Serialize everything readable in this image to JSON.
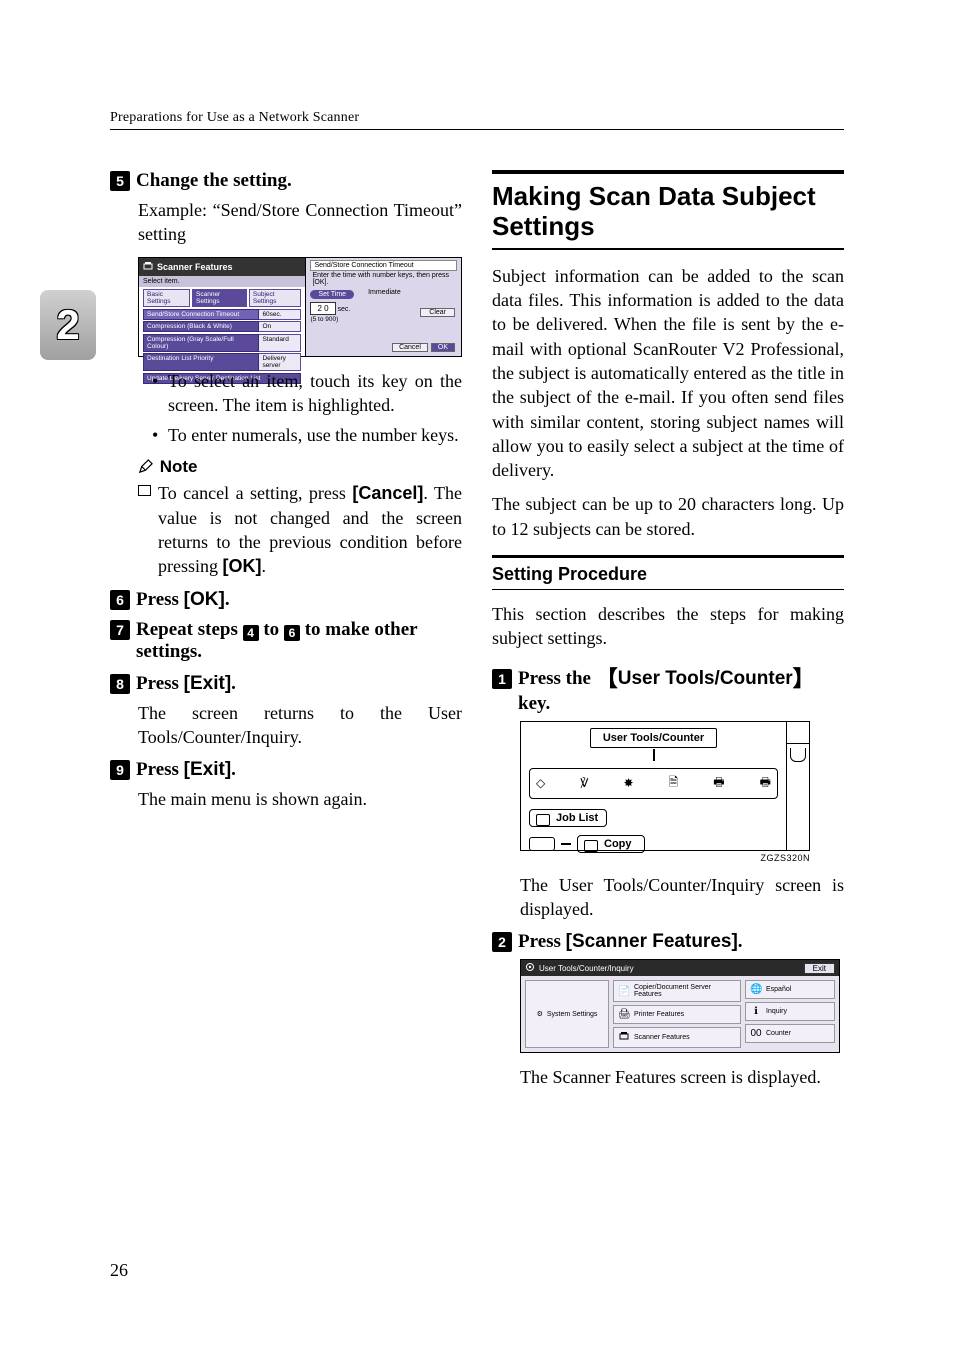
{
  "running_head": "Preparations for Use as a Network Scanner",
  "side_tab": "2",
  "page_number": "26",
  "left": {
    "step5": {
      "num": "5",
      "title": "Change the setting.",
      "example": "Example: “Send/Store Connection Timeout” setting",
      "bullet1": "To select an item, touch its key on the screen. The item is highlighted.",
      "bullet2": "To enter numerals, use the number keys.",
      "note_head": "Note",
      "note_body_a": "To cancel a setting, press ",
      "note_cancel": "[Cancel]",
      "note_body_b": ". The value is not changed and the screen returns to the previous condition before pressing ",
      "note_ok": "[OK]",
      "note_body_c": "."
    },
    "step6": {
      "num": "6",
      "a": "Press ",
      "b": "[OK]",
      "c": "."
    },
    "step7": {
      "num": "7",
      "a": "Repeat steps ",
      "s1": "4",
      "mid": " to ",
      "s2": "6",
      "b": " to make other settings."
    },
    "step8": {
      "num": "8",
      "a": "Press ",
      "b": "[Exit]",
      "c": ".",
      "body": "The screen returns to the User Tools/Counter/Inquiry."
    },
    "step9": {
      "num": "9",
      "a": "Press ",
      "b": "[Exit]",
      "c": ".",
      "body": "The main menu is shown again."
    },
    "shot": {
      "title": "Scanner Features",
      "select": "Select item.",
      "tab1": "Basic Settings",
      "tab2": "Scanner Settings",
      "tab3": "Subject Settings",
      "row1k": "Send/Store Connection Timeout",
      "row1v": "60sec.",
      "row2k": "Compression (Black & White)",
      "row2v": "On",
      "row3k": "Compression (Gray Scale/Full Colour)",
      "row3v": "Standard",
      "row4k": "Destination List Priority",
      "row4v": "Delivery server",
      "row5k": "Update Delivery Server Destination List",
      "rtitle": "Send/Store Connection Timeout",
      "rsub": "Enter the time with number keys, then press [OK].",
      "pill": "Set Time",
      "imm": "Immediate",
      "val": "2 0",
      "unit": "sec.",
      "range": "(5 to 900)",
      "clear": "Clear",
      "cancel": "Cancel",
      "ok": "OK"
    }
  },
  "right": {
    "h2": "Making Scan Data Subject Settings",
    "p1": "Subject information can be added to the scan data files. This information is added to the data to be delivered. When the file is sent by the e-mail with optional ScanRouter V2 Professional, the subject is automatically entered as the title in the subject of the e-mail. If you often send files with similar content, storing subject names will allow you to easily select a subject at the time of delivery.",
    "p2": "The subject can be up to 20 characters long. Up to 12 subjects can be stored.",
    "h3": "Setting Procedure",
    "p3": "This section describes the steps for making subject settings.",
    "step1": {
      "num": "1",
      "a": "Press the ",
      "key": "User Tools/Counter",
      "b": " key."
    },
    "panel": {
      "ut": "User Tools/Counter",
      "joblist": "Job List",
      "copy": "Copy",
      "caption": "ZGZS320N"
    },
    "after1": "The User Tools/Counter/Inquiry screen is displayed.",
    "step2": {
      "num": "2",
      "a": "Press ",
      "b": "[Scanner Features]",
      "c": "."
    },
    "utci": {
      "title": "User Tools/Counter/Inquiry",
      "exit": "Exit",
      "sys": "System Settings",
      "copier": "Copier/Document Server Features",
      "printer": "Printer Features",
      "scanner": "Scanner Features",
      "esp": "Español",
      "inq": "Inquiry",
      "counter": "Counter"
    },
    "after2": "The Scanner Features screen is displayed."
  }
}
